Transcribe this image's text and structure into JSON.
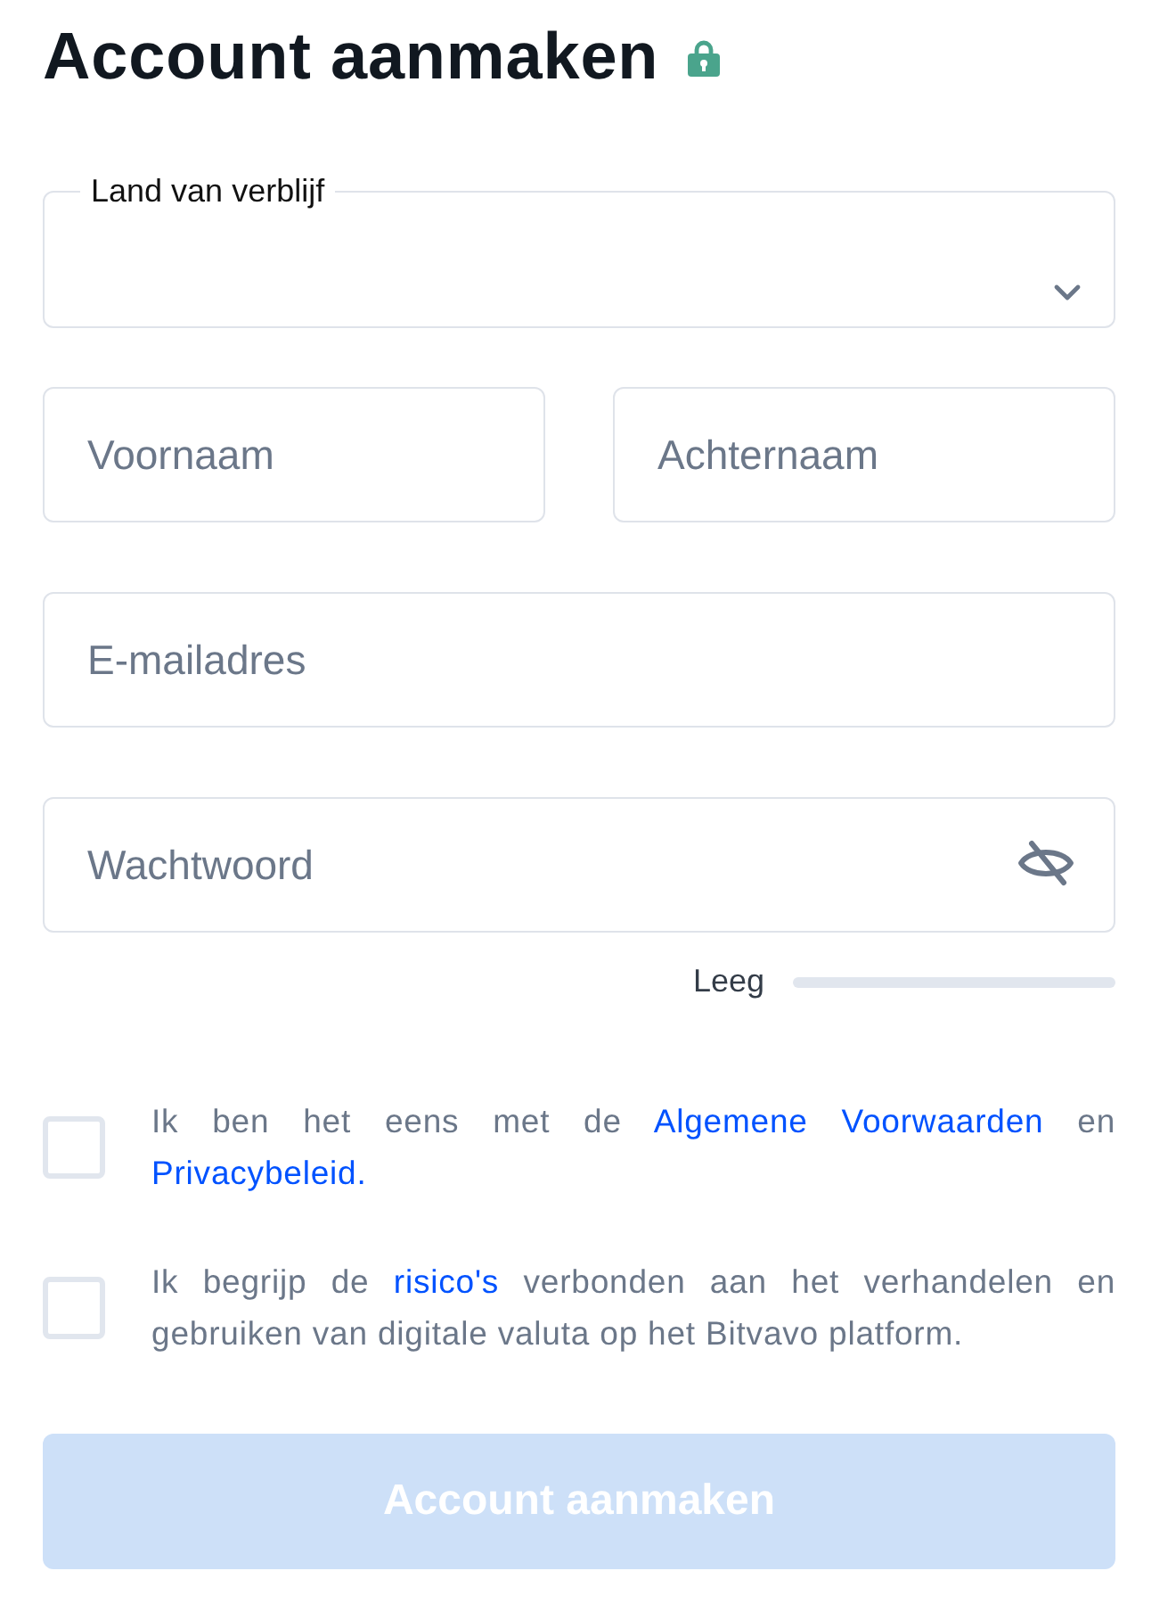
{
  "title": "Account aanmaken",
  "country_select": {
    "label": "Land van verblijf"
  },
  "fields": [
    {
      "placeholder": "Voornaam"
    },
    {
      "placeholder": "Achternaam"
    },
    {
      "placeholder": "E-mailadres"
    }
  ],
  "password": {
    "placeholder": "Wachtwoord",
    "strength_label": "Leeg",
    "level": 0
  },
  "agreements": [
    {
      "checked": false,
      "parts": [
        {
          "text": "Ik ben het eens met de "
        },
        {
          "text": "Algemene Voorwaarden",
          "kind": "link"
        },
        {
          "text": " en "
        },
        {
          "text": "Privacybeleid.",
          "kind": "link"
        }
      ]
    },
    {
      "checked": false,
      "parts": [
        {
          "text": "Ik begrijp de "
        },
        {
          "text": "risico's",
          "kind": "link"
        },
        {
          "text": " verbonden aan het verhandelen en gebruiken van digitale valuta op het Bitvavo platform."
        }
      ]
    }
  ],
  "submit": {
    "label": "Account aanmaken",
    "disabled": true
  }
}
